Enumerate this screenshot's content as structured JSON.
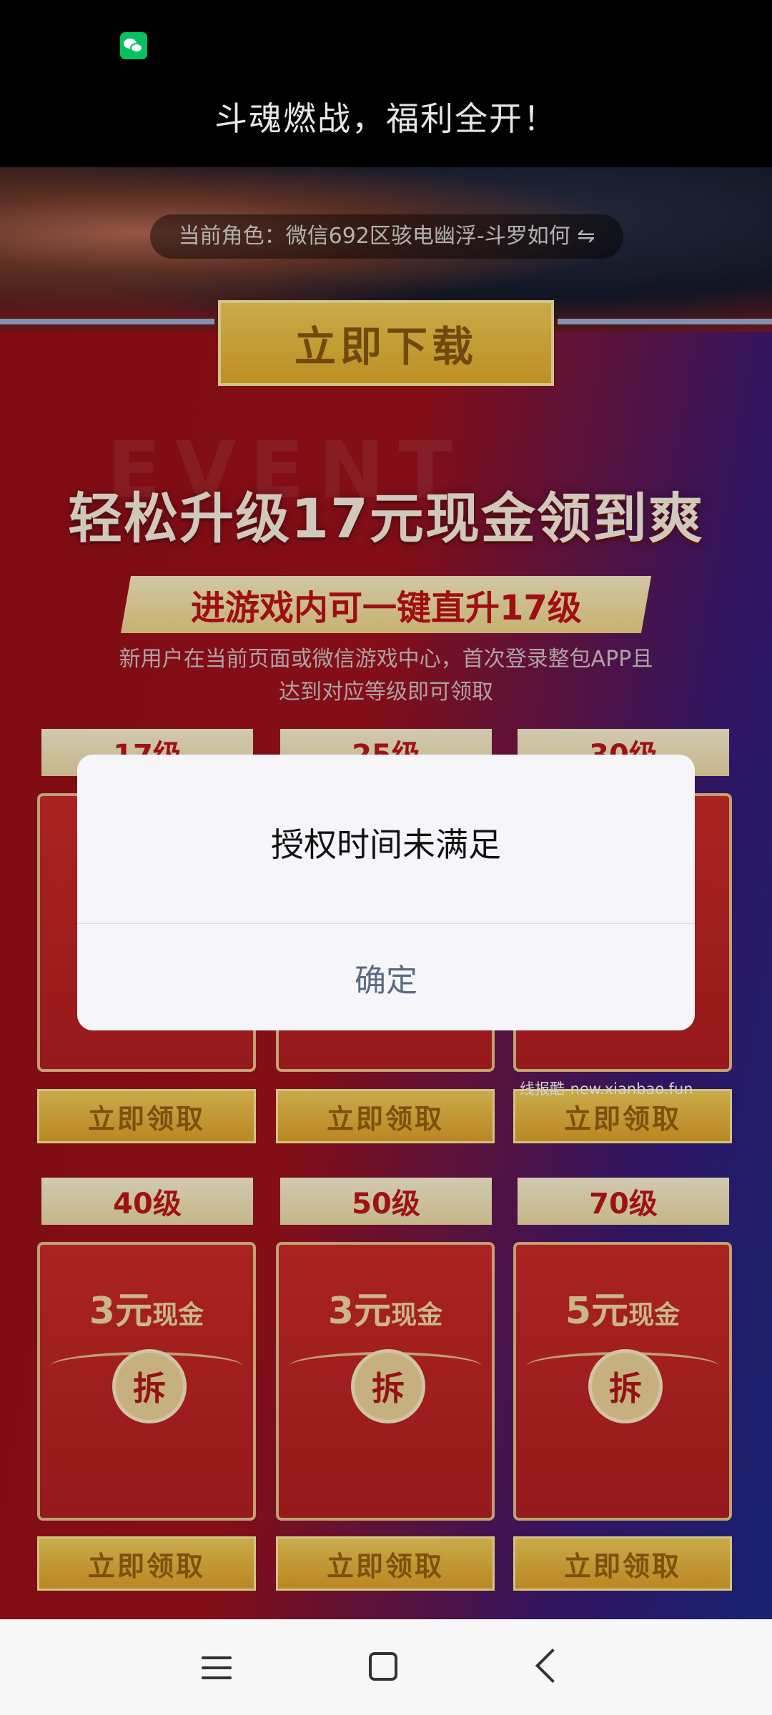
{
  "top_bar": {
    "title": "斗魂燃战，福利全开！"
  },
  "game": {
    "role_label": "当前角色：微信692区骇电幽浮-斗罗如何 ⇋",
    "download_button": "立即下载",
    "headline": "轻松升级17元现金领到爽",
    "sub_banner": "进游戏内可一键直升17级",
    "note_line1": "新用户在当前页面或微信游戏中心，首次登录整包APP且",
    "note_line2": "达到对应等级即可领取",
    "row1": {
      "tags": [
        "17级",
        "25级",
        "30级"
      ],
      "claim_label": "立即领取"
    },
    "row2": {
      "tags": [
        "40级",
        "50级",
        "70级"
      ],
      "packets": [
        {
          "amount": "3元",
          "unit": "现金",
          "seal": "拆"
        },
        {
          "amount": "3元",
          "unit": "现金",
          "seal": "拆"
        },
        {
          "amount": "5元",
          "unit": "现金",
          "seal": "拆"
        }
      ],
      "claim_label": "立即领取"
    },
    "watermark": "线报酷-new.xianbao.fun"
  },
  "dialog": {
    "message": "授权时间未满足",
    "confirm_label": "确定"
  },
  "navbar": {
    "menu_icon": "menu-icon",
    "home_icon": "home-square-icon",
    "back_icon": "back-chevron-icon"
  }
}
